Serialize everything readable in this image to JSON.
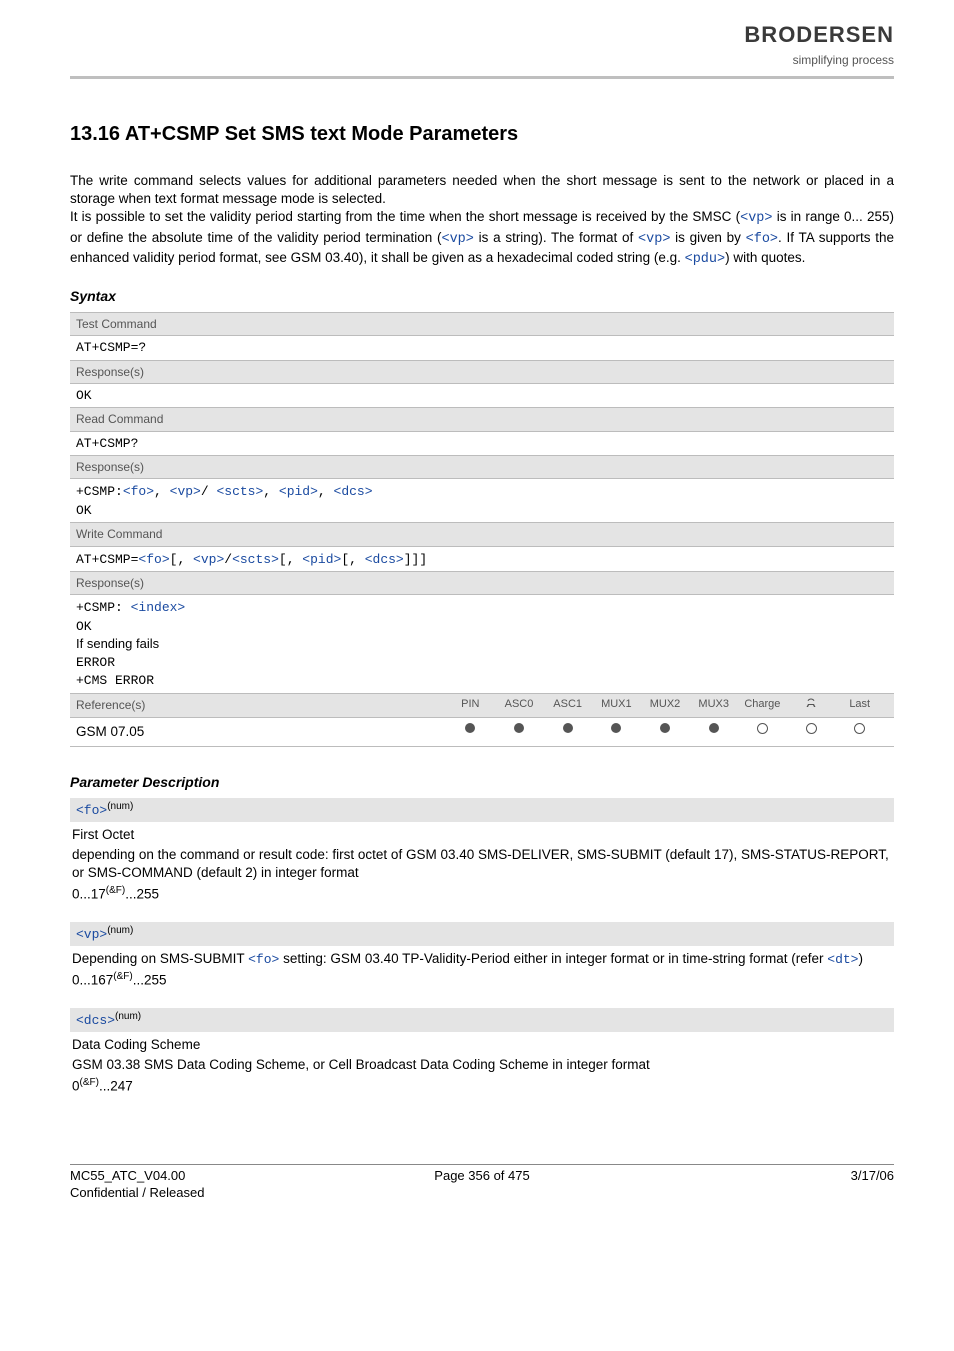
{
  "logo": {
    "name": "BRODERSEN",
    "tagline": "simplifying process"
  },
  "title": "13.16   AT+CSMP   Set SMS text Mode Parameters",
  "intro": {
    "p1a": "The write command selects values for additional parameters needed when the short message is sent to the network or placed in a storage when text format message mode is selected.",
    "p2a": "It is possible to set the validity period starting from the time when the short message is received by the SMSC (",
    "vp1": "<vp>",
    "p2b": " is in range 0... 255) or define the absolute time of the validity period termination (",
    "vp2": "<vp>",
    "p2c": " is a string). The format of ",
    "vp3": "<vp>",
    "p2d": " is given by ",
    "fo1": "<fo>",
    "p2e": ". If TA supports the enhanced validity period format, see GSM 03.40), it shall be given as a hexadecimal coded string (e.g. ",
    "pdu": "<pdu>",
    "p2f": ") with quotes."
  },
  "syntax_heading": "Syntax",
  "syntax": {
    "test_label": "Test Command",
    "test_cmd": "AT+CSMP=?",
    "resp_label": "Response(s)",
    "ok": "OK",
    "read_label": "Read Command",
    "read_cmd": "AT+CSMP?",
    "read_resp_prefix": "+CSMP:",
    "fo": "<fo>",
    "vp": "<vp>",
    "scts": "<scts>",
    "pid": "<pid>",
    "dcs": "<dcs>",
    "write_label": "Write Command",
    "write_cmd_prefix": "AT+CSMP=",
    "write_resp_prefix": "+CSMP: ",
    "index": "<index>",
    "fail": "If sending fails",
    "error": "ERROR",
    "cms_error": "+CMS ERROR"
  },
  "ref": {
    "label": "Reference(s)",
    "value": "GSM 07.05",
    "cols": [
      "PIN",
      "ASC0",
      "ASC1",
      "MUX1",
      "MUX2",
      "MUX3",
      "Charge",
      "",
      "Last"
    ],
    "dots": [
      "filled",
      "filled",
      "filled",
      "filled",
      "filled",
      "filled",
      "empty",
      "empty",
      "empty"
    ]
  },
  "param_heading": "Parameter Description",
  "params": {
    "fo": {
      "tag": "<fo>",
      "sup": "(num)",
      "title": "First Octet",
      "desc": "depending on the command or result code: first octet of GSM 03.40 SMS-DELIVER, SMS-SUBMIT (default 17), SMS-STATUS-REPORT, or SMS-COMMAND (default 2) in integer format",
      "range_a": "0...17",
      "range_sup": "(&F)",
      "range_b": "...255"
    },
    "vp": {
      "tag": "<vp>",
      "sup": "(num)",
      "desc_a": "Depending on SMS-SUBMIT ",
      "desc_fo": "<fo>",
      "desc_b": " setting: GSM 03.40 TP-Validity-Period either in integer format or in time-string format (refer ",
      "desc_dt": "<dt>",
      "desc_c": ")",
      "range_a": "0...167",
      "range_sup": "(&F)",
      "range_b": "...255"
    },
    "dcs": {
      "tag": "<dcs>",
      "sup": "(num)",
      "title": "Data Coding Scheme",
      "desc": "GSM 03.38 SMS Data Coding Scheme, or Cell Broadcast Data Coding Scheme in integer format",
      "range_a": "0",
      "range_sup": "(&F)",
      "range_b": "...247"
    }
  },
  "footer": {
    "left1": "MC55_ATC_V04.00",
    "left2": "Confidential / Released",
    "center": "Page 356 of 475",
    "right": "3/17/06"
  }
}
